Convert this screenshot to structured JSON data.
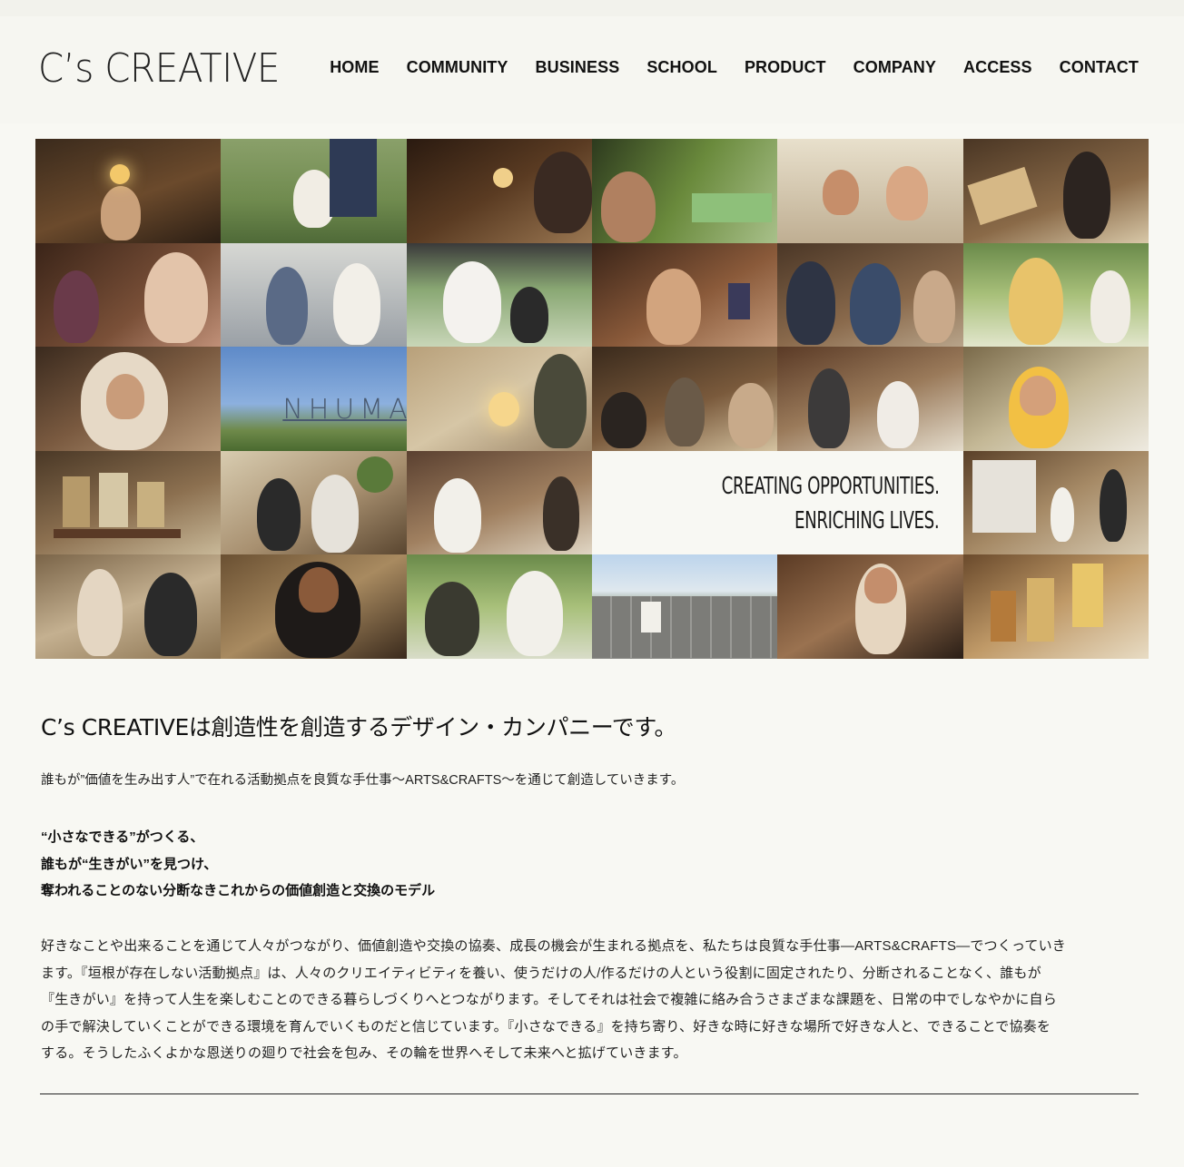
{
  "header": {
    "logo": "C’s CREATIVE",
    "nav": [
      "HOME",
      "COMMUNITY",
      "BUSINESS",
      "SCHOOL",
      "PRODUCT",
      "COMPANY",
      "ACCESS",
      "CONTACT"
    ]
  },
  "hero": {
    "tagline_line1": "CREATING OPPORTUNITIES.",
    "tagline_line2": "ENRICHING LIVES.",
    "photo_sign_text": "NHUMA"
  },
  "content": {
    "heading": "C’s CREATIVEは創造性を創造するデザイン・カンパニーです。",
    "lead": "誰もが”価値を生み出す人”で在れる活動拠点を良質な手仕事〜ARTS&CRAFTS〜を通じて創造していきます。",
    "bold_lines": [
      "“小さなできる”がつくる、",
      "誰もが“生きがい”を見つけ、",
      "奪われることのない分断なきこれからの価値創造と交換のモデル"
    ],
    "body_lines": [
      "好きなことや出来ることを通じて人々がつながり、価値創造や交換の協奏、成長の機会が生まれる拠点を、私たちは良質な手仕事—ARTS&CRAFTS—でつくっていき",
      "ます。『垣根が存在しない活動拠点』は、人々のクリエイティビティを養い、使うだけの人/作るだけの人という役割に固定されたり、分断されることなく、誰もが",
      "『生きがい』を持って人生を楽しむことのできる暮らしづくりへとつながります。そしてそれは社会で複雑に絡み合うさまざまな課題を、日常の中でしなやかに自ら",
      "の手で解決していくことができる環境を育んでいくものだと信じています。『小さなできる』を持ち寄り、好きな時に好きな場所で好きな人と、できることで協奏を",
      "する。そうしたふくよかな恩送りの廻りで社会を包み、その輪を世界へそして未来へと拡げていきます。"
    ]
  }
}
